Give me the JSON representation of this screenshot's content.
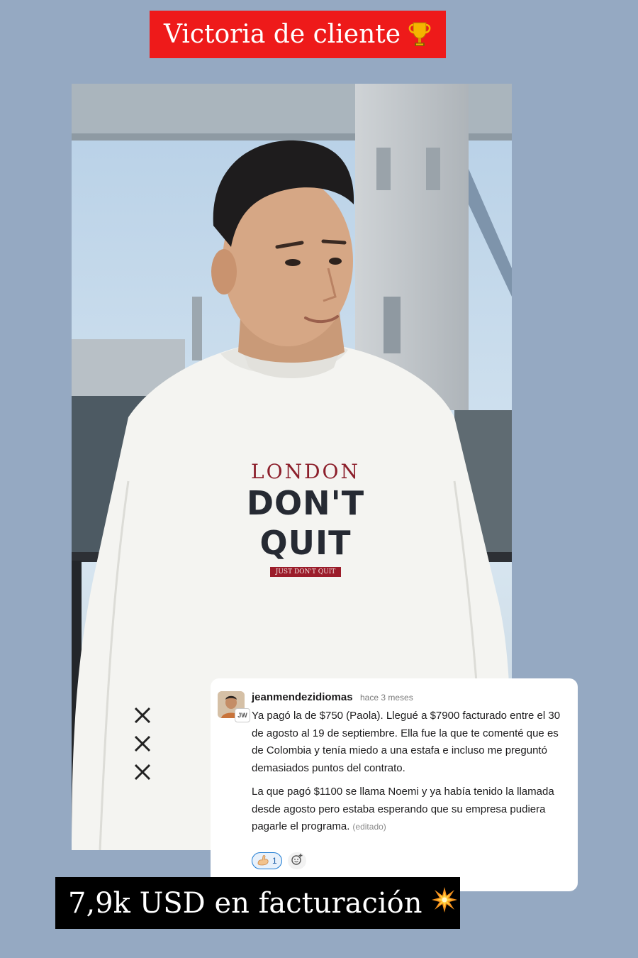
{
  "title_banner": {
    "text": "Victoria de cliente",
    "icon": "trophy-icon"
  },
  "photo": {
    "subject": "man-in-white-sweatshirt",
    "shirt": {
      "city": "LONDON",
      "slogan": "DON'T QUIT",
      "tag": "JUST DON'T QUIT"
    }
  },
  "comment": {
    "username": "jeanmendezidiomas",
    "time": "hace 3 meses",
    "avatar_badge": "JW",
    "paragraph1": "Ya pagó la de $750 (Paola). Llegué a $7900 facturado entre el 30 de agosto al 19 de septiembre. Ella fue la que te comenté que es de Colombia y tenía miedo a una estafa e incluso me preguntó demasiados puntos del contrato.",
    "paragraph2": "La que pagó $1100 se llama Noemi y ya había tenido la llamada desde agosto pero estaba esperando que su empresa pudiera pagarle el programa.",
    "edited": "(editado)",
    "reaction": {
      "icon": "flexed-biceps-icon",
      "count": "1"
    },
    "add_reaction_icon": "add-emoji-icon"
  },
  "bottom_banner": {
    "text": "7,9k USD en facturación",
    "icon": "collision-icon"
  },
  "colors": {
    "page_background": "#95a9c2",
    "title_banner": "#ee1a1a",
    "bottom_banner": "#000000",
    "reaction_accent": "#1d7bd3"
  }
}
